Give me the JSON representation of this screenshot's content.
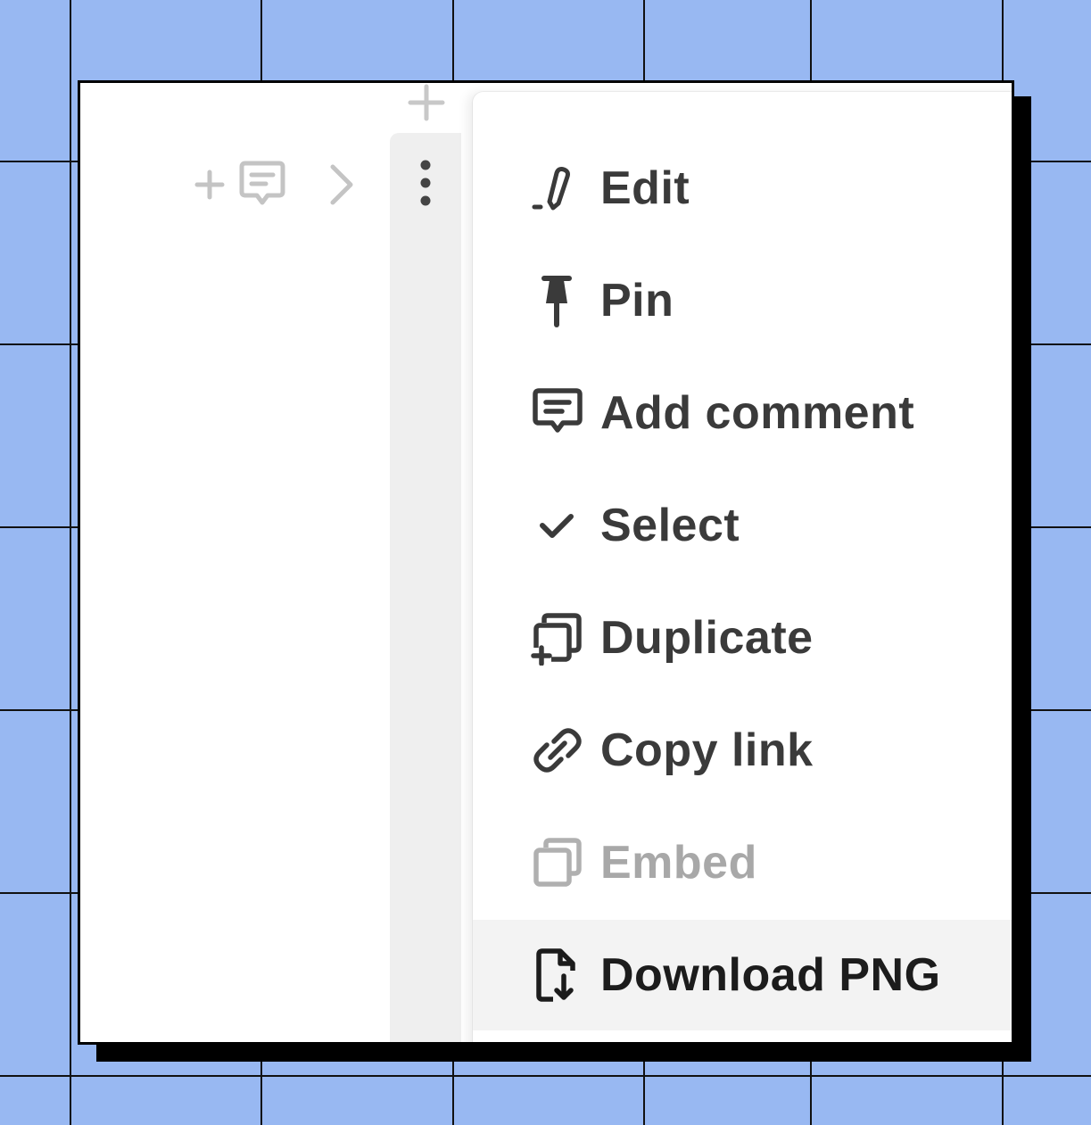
{
  "colors": {
    "background": "#98b8f2",
    "grid_lines": "#111111",
    "menu_text": "#3a3a3a",
    "disabled_text": "#a8a8a8",
    "active_row": "#f3f3f3",
    "muted_icon": "#c4c4c4"
  },
  "toolbar": {
    "icons": [
      "plus-icon",
      "comment-icon",
      "chevron-right-icon",
      "more-vertical-icon"
    ]
  },
  "menu": {
    "items": [
      {
        "label": "Edit",
        "icon": "pencil-icon",
        "state": "normal"
      },
      {
        "label": "Pin",
        "icon": "pin-icon",
        "state": "normal"
      },
      {
        "label": "Add comment",
        "icon": "comment-icon",
        "state": "normal"
      },
      {
        "label": "Select",
        "icon": "check-icon",
        "state": "normal"
      },
      {
        "label": "Duplicate",
        "icon": "duplicate-icon",
        "state": "normal"
      },
      {
        "label": "Copy link",
        "icon": "link-icon",
        "state": "normal"
      },
      {
        "label": "Embed",
        "icon": "embed-icon",
        "state": "disabled"
      },
      {
        "label": "Download PNG",
        "icon": "download-file-icon",
        "state": "active"
      }
    ]
  }
}
